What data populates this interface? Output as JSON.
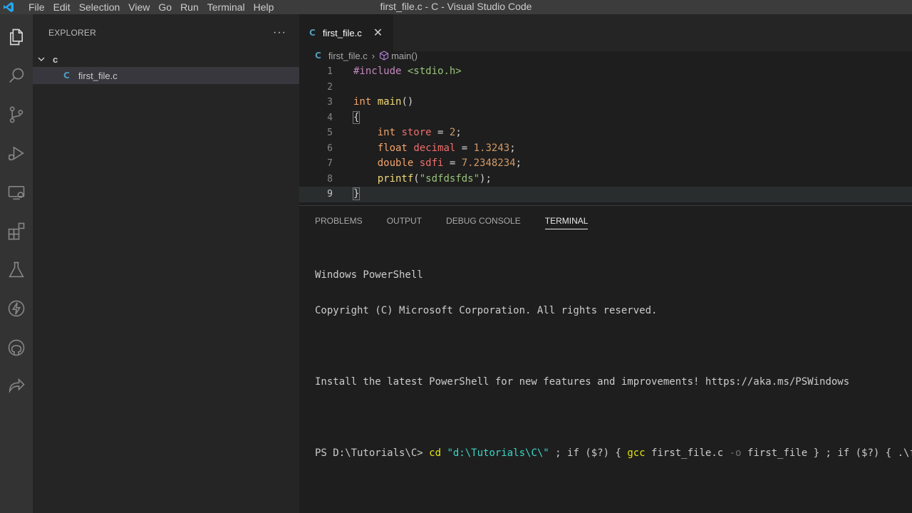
{
  "window_title": "first_file.c - C - Visual Studio Code",
  "menu": [
    "File",
    "Edit",
    "Selection",
    "View",
    "Go",
    "Run",
    "Terminal",
    "Help"
  ],
  "activity_icons": [
    "explorer-icon",
    "search-icon",
    "source-control-icon",
    "run-debug-icon",
    "remote-explorer-icon",
    "extensions-icon",
    "testing-icon",
    "thunder-icon",
    "github-icon",
    "live-share-icon"
  ],
  "sidebar": {
    "title": "EXPLORER",
    "more": "···",
    "folder": "c",
    "file": "first_file.c",
    "file_icon": "C"
  },
  "editor": {
    "tab_icon": "C",
    "tab_label": "first_file.c",
    "close": "✕",
    "breadcrumb": {
      "file": "first_file.c",
      "symbol": "main()"
    },
    "line_numbers": [
      "1",
      "2",
      "3",
      "4",
      "5",
      "6",
      "7",
      "8",
      "9"
    ],
    "lines": {
      "l1_directive": "#include",
      "l1_header": " <stdio.h>",
      "l3_type": "int",
      "l3_fn": "main",
      "l3_rest": "()",
      "l4": "{",
      "l5_type": "int",
      "l5_var": "store",
      "l5_eq": " = ",
      "l5_num": "2",
      "l5_end": ";",
      "l6_type": "float",
      "l6_var": "decimal",
      "l6_eq": " = ",
      "l6_num": "1.3243",
      "l6_end": ";",
      "l7_type": "double",
      "l7_var": "sdfi",
      "l7_eq": " = ",
      "l7_num": "7.2348234",
      "l7_end": ";",
      "l8_fn": "printf",
      "l8_open": "(",
      "l8_str": "\"sdfdsfds\"",
      "l8_end": ");",
      "l9": "}"
    }
  },
  "panel": {
    "tabs": [
      "PROBLEMS",
      "OUTPUT",
      "DEBUG CONSOLE",
      "TERMINAL"
    ],
    "active_tab": "TERMINAL",
    "terminal": {
      "line1": "Windows PowerShell",
      "line2": "Copyright (C) Microsoft Corporation. All rights reserved.",
      "line3": "Install the latest PowerShell for new features and improvements! https://aka.ms/PSWindows",
      "prompt": "PS D:\\Tutorials\\C> ",
      "cmd_cd": "cd",
      "cmd_path": " \"d:\\Tutorials\\C\\\"",
      "cmd_part1": " ; if ($?) { ",
      "cmd_gcc": "gcc",
      "cmd_part2": " first_file.c ",
      "cmd_flag": "-o",
      "cmd_part3": " first_file } ; if ($?) { .\\first"
    }
  },
  "colors": {
    "accent_blue": "#007acc",
    "c_icon": "#519aba",
    "keyword": "#f4a46a",
    "function": "#f1d97a",
    "variable": "#ef6f6c"
  }
}
